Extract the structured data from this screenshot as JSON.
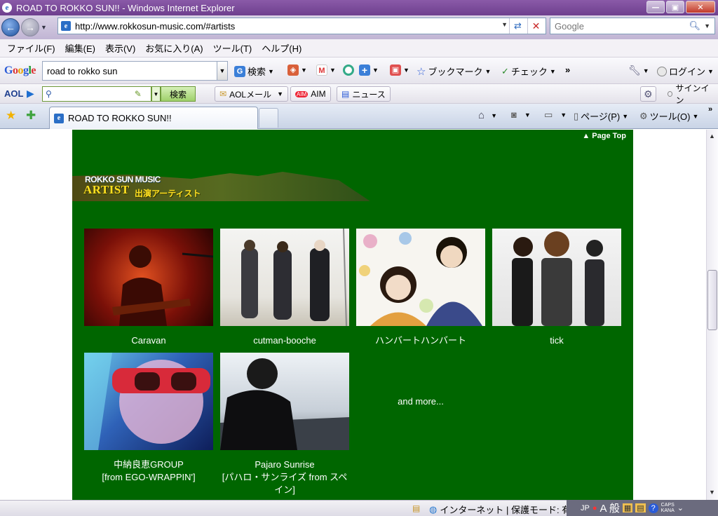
{
  "window": {
    "title": "ROAD TO ROKKO SUN!! - Windows Internet Explorer",
    "minimize": "—",
    "maximize": "▣",
    "close": "✕"
  },
  "address": {
    "url": "http://www.rokkosun-music.com/#artists",
    "search_placeholder": "Google"
  },
  "menu": {
    "items": [
      "ファイル(F)",
      "編集(E)",
      "表示(V)",
      "お気に入り(A)",
      "ツール(T)",
      "ヘルプ(H)"
    ]
  },
  "google_toolbar": {
    "logo": "Google",
    "query": "road to rokko sun",
    "search_label": "検索",
    "bookmark_label": "ブックマーク",
    "check_label": "チェック",
    "more": "»",
    "login_label": "ログイン"
  },
  "aol_toolbar": {
    "logo": "AOL",
    "search_label": "検索",
    "mail_label": "AOLメール",
    "aim_label": "AIM",
    "news_label": "ニュース",
    "signin_label": "サインイン"
  },
  "tabs": {
    "active_title": "ROAD TO ROKKO SUN!!",
    "page_label": "ページ(P)",
    "tools_label": "ツール(O)"
  },
  "page": {
    "page_top": "▲ Page Top",
    "banner_sub": "ROKKO SUN MUSIC",
    "banner_main": "ARTIST",
    "banner_jp": "出演アーティスト",
    "artists": [
      {
        "name": "Caravan",
        "sub": ""
      },
      {
        "name": "cutman-booche",
        "sub": ""
      },
      {
        "name": "ハンバートハンバート",
        "sub": ""
      },
      {
        "name": "tick",
        "sub": ""
      },
      {
        "name": "中納良恵GROUP",
        "sub": "[from EGO-WRAPPIN']"
      },
      {
        "name": "Pajaro Sunrise",
        "sub": "[パハロ・サンライズ from スペイン]"
      }
    ],
    "and_more": "and more..."
  },
  "status": {
    "zone": "インターネット | 保護モード: 有",
    "ime_lang": "JP",
    "ime_mode": "A 般",
    "caps": "CAPS",
    "kana": "KANA"
  },
  "colors": {
    "page_green": "#006600",
    "banner_yellow": "#ffe020",
    "titlebar": "#7a4a9a"
  }
}
